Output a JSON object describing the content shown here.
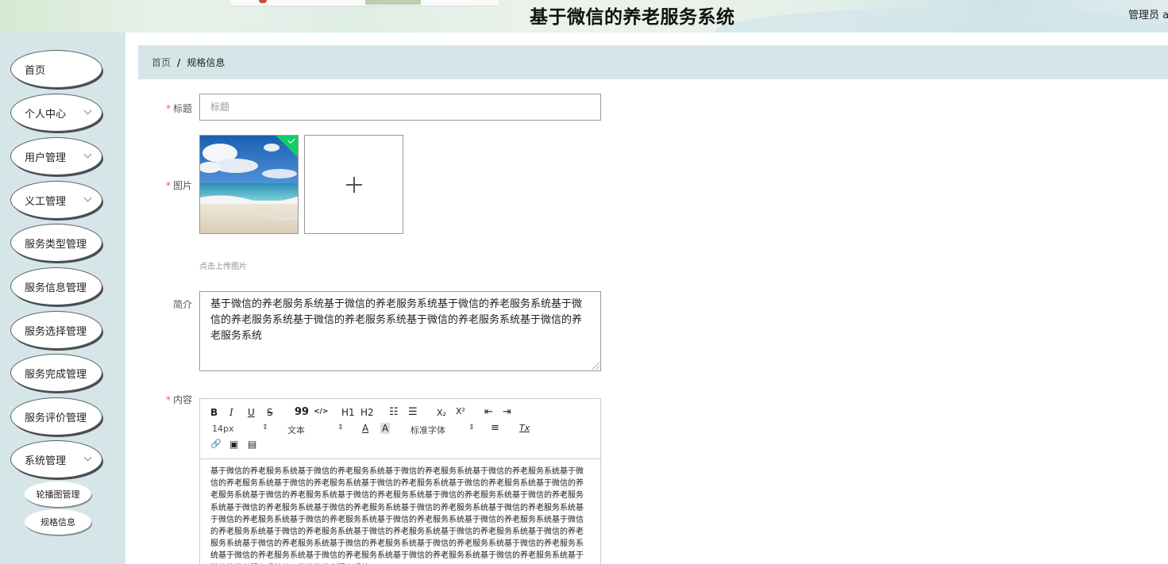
{
  "app": {
    "title": "基于微信的养老服务系统",
    "user_label": "管理员 a"
  },
  "sidebar": {
    "items": [
      {
        "label": "首页",
        "has_arrow": false
      },
      {
        "label": "个人中心",
        "has_arrow": true
      },
      {
        "label": "用户管理",
        "has_arrow": true
      },
      {
        "label": "义工管理",
        "has_arrow": true
      },
      {
        "label": "服务类型管理",
        "has_arrow": false
      },
      {
        "label": "服务信息管理",
        "has_arrow": false
      },
      {
        "label": "服务选择管理",
        "has_arrow": false
      },
      {
        "label": "服务完成管理",
        "has_arrow": false
      },
      {
        "label": "服务评价管理",
        "has_arrow": false
      },
      {
        "label": "系统管理",
        "has_arrow": true
      }
    ],
    "sub_items": [
      {
        "label": "轮播图管理"
      },
      {
        "label": "规格信息"
      }
    ]
  },
  "breadcrumb": {
    "home": "首页",
    "separator": "/",
    "current": "规格信息"
  },
  "form": {
    "title_label": "标题",
    "title_placeholder": "标题",
    "image_label": "图片",
    "upload_hint": "点击上传图片",
    "desc_label": "简介",
    "desc_value": "基于微信的养老服务系统基于微信的养老服务系统基于微信的养老服务系统基于微信的养老服务系统基于微信的养老服务系统基于微信的养老服务系统基于微信的养老服务系统",
    "content_label": "内容",
    "required_mark": "*"
  },
  "editor": {
    "toolbar": {
      "bold": "B",
      "italic": "I",
      "underline": "U",
      "strike": "S",
      "quote": "99",
      "code": "</>",
      "h1": "H1",
      "h2": "H2",
      "ordered_list": "☷",
      "bullet_list": "☰",
      "subscript": "X₂",
      "superscript": "X²",
      "indent_less": "⇤",
      "indent_more": "⇥",
      "size_value": "14px",
      "header_value": "文本",
      "color": "A",
      "background": "A",
      "font_value": "标准字体",
      "align": "≡",
      "clean": "Tx",
      "link": "🔗",
      "image": "▣",
      "video": "▤"
    },
    "content": "基于微信的养老服务系统基于微信的养老服务系统基于微信的养老服务系统基于微信的养老服务系统基于微信的养老服务系统基于微信的养老服务系统基于微信的养老服务系统基于微信的养老服务系统基于微信的养老服务系统基于微信的养老服务系统基于微信的养老服务系统基于微信的养老服务系统基于微信的养老服务系统基于微信的养老服务系统基于微信的养老服务系统基于微信的养老服务系统基于微信的养老服务系统基于微信的养老服务系统基于微信的养老服务系统基于微信的养老服务系统基于微信的养老服务系统基于微信的养老服务系统基于微信的养老服务系统基于微信的养老服务系统基于微信的养老服务系统基于微信的养老服务系统基于微信的养老服务系统基于微信的养老服务系统基于微信的养老服务系统基于微信的养老服务系统基于微信的养老服务系统基于微信的养老服务系统基于微信的养老服务系统基于微信的养老服务系统基于微信的养老服务系统基于微信的养老服务系统"
  },
  "colors": {
    "sidebar_bg": "#d6e6e8",
    "required": "#e45d5d",
    "success": "#13ce66"
  }
}
